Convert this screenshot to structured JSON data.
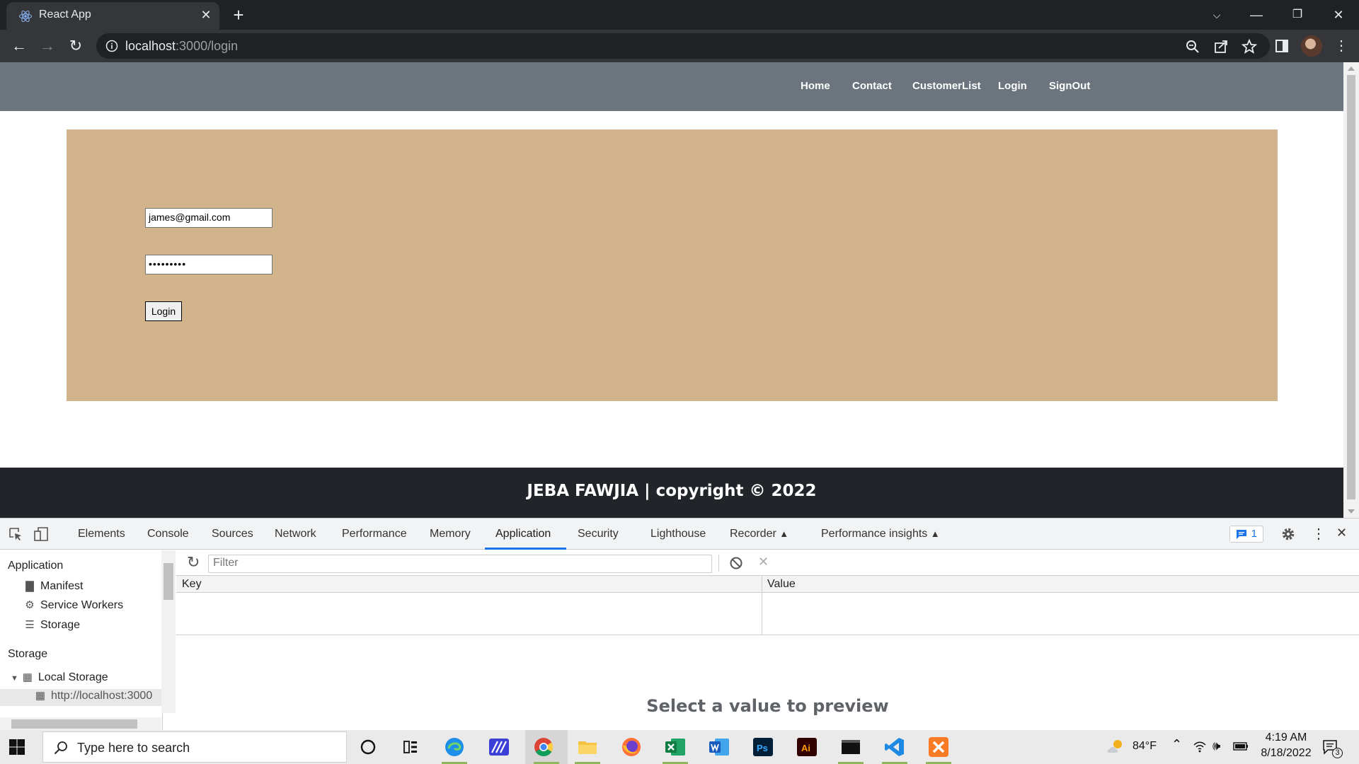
{
  "browser": {
    "tab_title": "React App",
    "url_host": "localhost",
    "url_path": ":3000/login"
  },
  "site": {
    "nav": [
      "Home",
      "Contact",
      "CustomerList",
      "Login",
      "SignOut"
    ],
    "email_value": "james@gmail.com",
    "password_value": "•••••••••",
    "login_button": "Login",
    "footer_text": "JEBA FAWJIA | copyright © 2022",
    "panel_color": "#d2b48c",
    "nav_color": "#6c757d",
    "footer_color": "#212529"
  },
  "devtools": {
    "tabs": [
      "Elements",
      "Console",
      "Sources",
      "Network",
      "Performance",
      "Memory",
      "Application",
      "Security",
      "Lighthouse",
      "Recorder",
      "Performance insights"
    ],
    "active_tab": "Application",
    "issues_count": "1",
    "sidebar": {
      "application_heading": "Application",
      "application_items": [
        "Manifest",
        "Service Workers",
        "Storage"
      ],
      "storage_heading": "Storage",
      "local_storage": "Local Storage",
      "local_storage_child": "http://localhost:3000"
    },
    "filter_placeholder": "Filter",
    "columns": [
      "Key",
      "Value"
    ],
    "preview_text": "Select a value to preview"
  },
  "taskbar": {
    "search_placeholder": "Type here to search",
    "temperature": "84°F",
    "time": "4:19 AM",
    "date": "8/18/2022",
    "notification_count": "3"
  }
}
